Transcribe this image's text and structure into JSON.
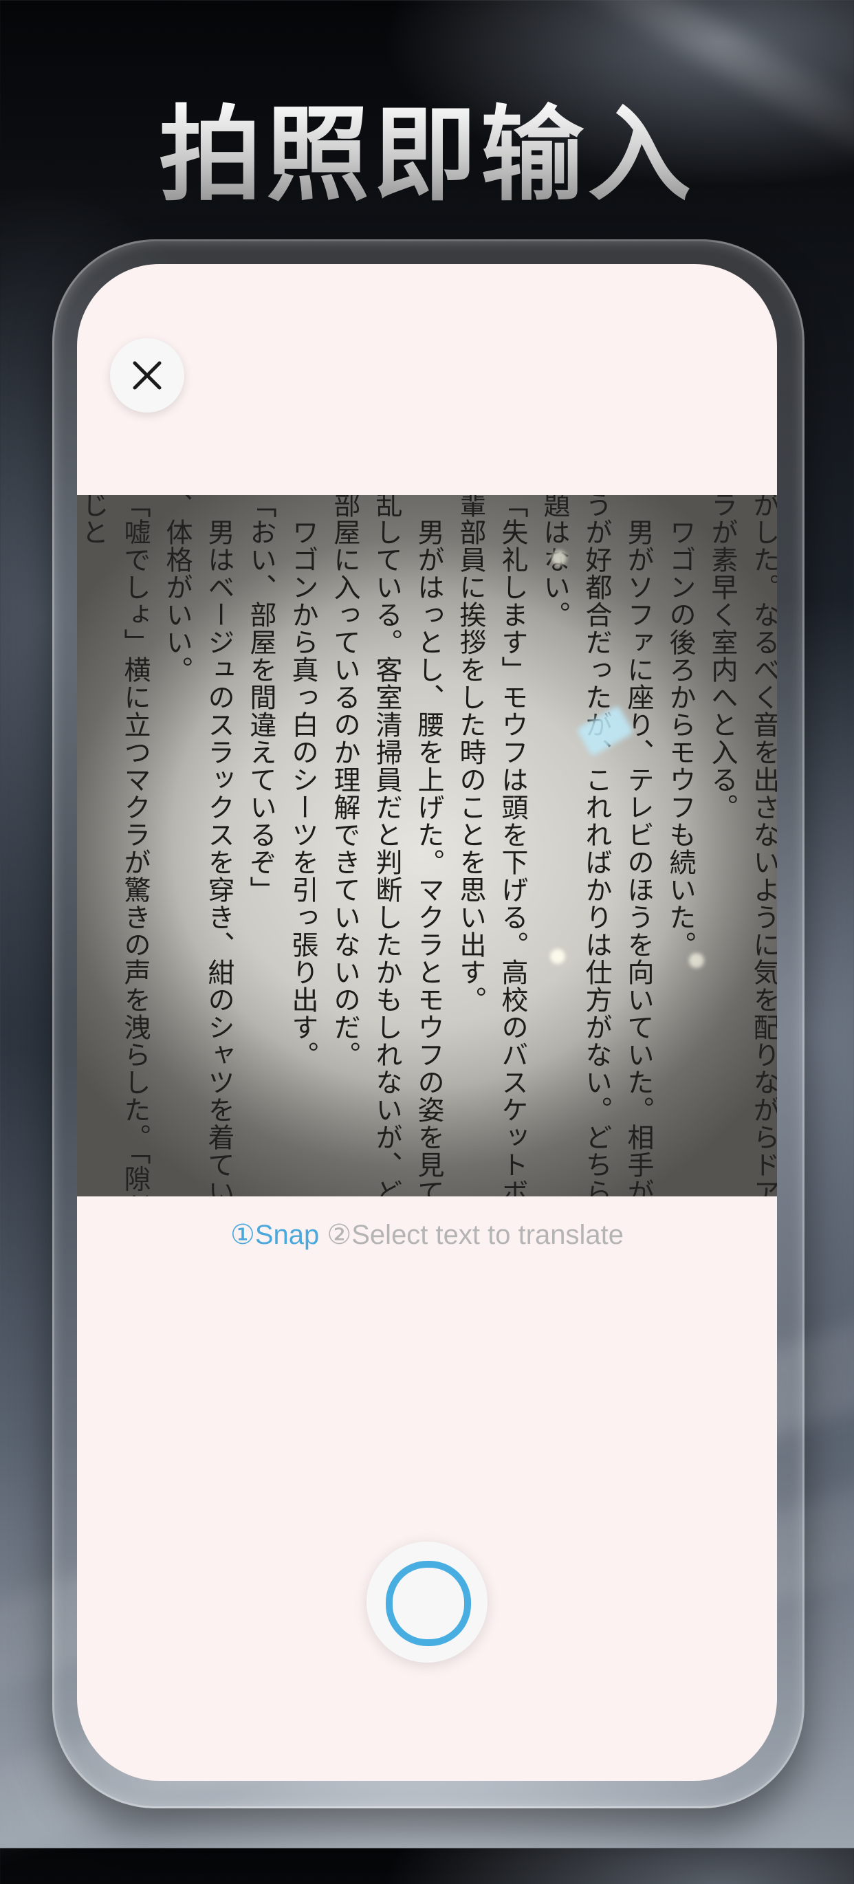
{
  "headline": "拍照即输入",
  "camera": {
    "close_icon": "close-icon",
    "photo_text": "がした。なるべく音を出さないように気を配りながらドアを開き\nラが素早く室内へと入る。\n　ワゴンの後ろからモウフも続いた。\n　男がソファに座り、テレビのほうを向いていた。相手が立って\nうが好都合だったが、これればかりは仕方がない。どちらにせよ\n題はない。\n「失礼します」モウフは頭を下げる。高校のバスケットボール部\n輩部員に挨拶をした時のことを思い出す。\n　男がはっとし、腰を上げた。マクラとモウフの姿を見て、明ら\n乱している。客室清掃員だと判断したかもしれないが、どうして\n部屋に入っているのか理解できていないのだ。\n　ワゴンから真っ白のシーツを引っ張り出す。\n「おい、部屋を間違えているぞ」\n　男はベージュのスラックスを穿き、紺のシャツを着ていた。\n、体格がいい。\n「嘘でしょ」横に立つマクラが驚きの声を洩らした。「隙だらけ\nじと"
  },
  "steps": {
    "step1": "①Snap",
    "step2": "②Select text to translate"
  },
  "shutter": {
    "icon": "shutter-icon",
    "accent_color": "#48aee2"
  }
}
